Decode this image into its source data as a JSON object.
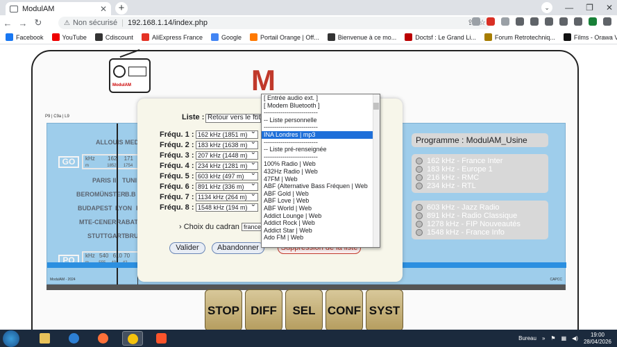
{
  "browser": {
    "tab_title": "ModulAM",
    "address_security": "Non sécurisé",
    "address_url": "192.168.1.14/index.php",
    "bookmarks": [
      "Facebook",
      "YouTube",
      "Cdiscount",
      "AliExpress France",
      "Google",
      "Portail Orange | Off...",
      "Bienvenue à ce mo...",
      "Doctsf : Le Grand Li...",
      "Forum Retrotechniq...",
      "Films - Orawa VOD"
    ]
  },
  "page": {
    "big_letter": "M",
    "page_tag": "P9 | C9a | L9",
    "dial": {
      "stations": [
        "ALLOUIS",
        "MED",
        "PARIS II",
        "TUNI",
        "BEROMÜNSTER",
        "B.B",
        "BUDAPEST",
        "LYON",
        "R",
        "MTE-CENERI",
        "RABAT",
        "STUTTGART",
        "BRU"
      ],
      "bands": [
        "GO",
        "PO"
      ],
      "go_scale": [
        "kHz",
        "162",
        "171",
        "m",
        "1852",
        "1754"
      ],
      "po_scale": [
        "kHz",
        "540",
        "610",
        "70",
        "m",
        "555",
        "491",
        "42"
      ],
      "footer_left": "ModulAM - 2024",
      "footer_right": "CAPCC"
    },
    "programme_title": "Programme : ModulAM_Usine",
    "programme_group1": [
      "162 kHz - France Inter",
      "183 kHz - Europe 1",
      "216 kHz - RMC",
      "234 kHz - RTL"
    ],
    "programme_group2": [
      "603 kHz - Jazz Radio",
      "891 kHz - Radio Classique",
      "1278 kHz - FIP Nouveautés",
      "1548 kHz - France Info"
    ],
    "keys": [
      "STOP",
      "DIFF",
      "SEL",
      "CONF",
      "SYST"
    ]
  },
  "dialog": {
    "liste_label": "Liste :",
    "liste_value": "Retour vers le futur",
    "frequencies": [
      {
        "label": "Fréqu. 1 :",
        "value": "162 kHz (1851 m)"
      },
      {
        "label": "Fréqu. 2 :",
        "value": "183 kHz (1638 m)"
      },
      {
        "label": "Fréqu. 3 :",
        "value": "207 kHz (1448 m)"
      },
      {
        "label": "Fréqu. 4 :",
        "value": "234 kHz (1281 m)"
      },
      {
        "label": "Fréqu. 5 :",
        "value": "603 kHz (497 m)"
      },
      {
        "label": "Fréqu. 6 :",
        "value": "891 kHz (336 m)"
      },
      {
        "label": "Fréqu. 7 :",
        "value": "1134 kHz (264 m)"
      },
      {
        "label": "Fréqu. 8 :",
        "value": "1548 kHz (194 m)"
      }
    ],
    "freq8_station_value": "--",
    "cadran_label": "Choix du cadran",
    "cadran_value": "france - échelle décroissante - marron",
    "validate_label": "Valider",
    "cancel_label": "Abandonner",
    "delete_label": "Suppression de la liste"
  },
  "dropdown": {
    "items": [
      "[ Entrée audio ext. ]",
      "[ Modem Bluetooth ]",
      "--------------------------",
      "-- Liste personnelle",
      "--------------------------",
      "INA Londres | mp3",
      "--------------------------",
      "-- Liste pré-renseignée",
      "--------------------------",
      "100% Radio | Web",
      "432Hz Radio | Web",
      "47FM | Web",
      "ABF (Alternative Bass Fréquen | Web",
      "ABF Gold | Web",
      "ABF Love | Web",
      "ABF World | Web",
      "Addict Lounge | Web",
      "Addict Rock | Web",
      "Addict Star | Web",
      "Ado FM | Web"
    ],
    "highlighted_index": 5
  },
  "taskbar": {
    "tray_label": "Bureau",
    "time": "19:00",
    "date": "28/04/2026"
  }
}
